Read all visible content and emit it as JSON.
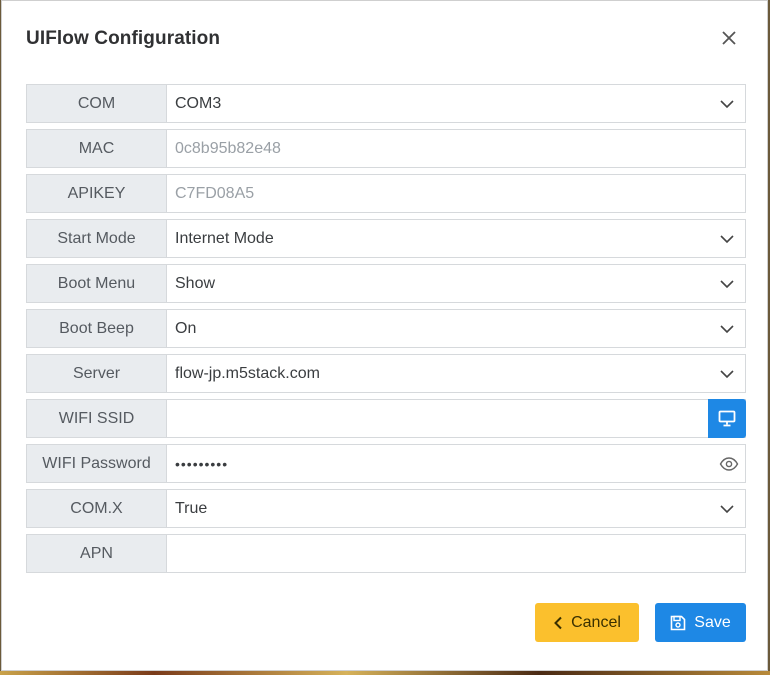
{
  "dialog": {
    "title": "UIFlow Configuration"
  },
  "fields": [
    {
      "label": "COM",
      "value": "COM3",
      "type": "select"
    },
    {
      "label": "MAC",
      "value": "0c8b95b82e48",
      "type": "readonly"
    },
    {
      "label": "APIKEY",
      "value": "C7FD08A5",
      "type": "readonly"
    },
    {
      "label": "Start Mode",
      "value": "Internet Mode",
      "type": "select"
    },
    {
      "label": "Boot Menu",
      "value": "Show",
      "type": "select"
    },
    {
      "label": "Boot Beep",
      "value": "On",
      "type": "select"
    },
    {
      "label": "Server",
      "value": "flow-jp.m5stack.com",
      "type": "select"
    },
    {
      "label": "WIFI SSID",
      "value": "",
      "type": "text"
    },
    {
      "label": "WIFI Password",
      "value": "•••••••••",
      "type": "password"
    },
    {
      "label": "COM.X",
      "value": "True",
      "type": "select"
    },
    {
      "label": "APN",
      "value": "",
      "type": "text"
    }
  ],
  "buttons": {
    "cancel": "Cancel",
    "save": "Save"
  },
  "icons": {
    "close": "close-icon",
    "chevron": "chevron-down-icon",
    "monitor": "monitor-icon",
    "eye": "eye-icon",
    "back": "chevron-left-icon",
    "save": "floppy-disk-icon"
  },
  "colors": {
    "primary": "#1e88e5",
    "warning": "#fbc02d",
    "label_bg": "#e9ecef"
  }
}
